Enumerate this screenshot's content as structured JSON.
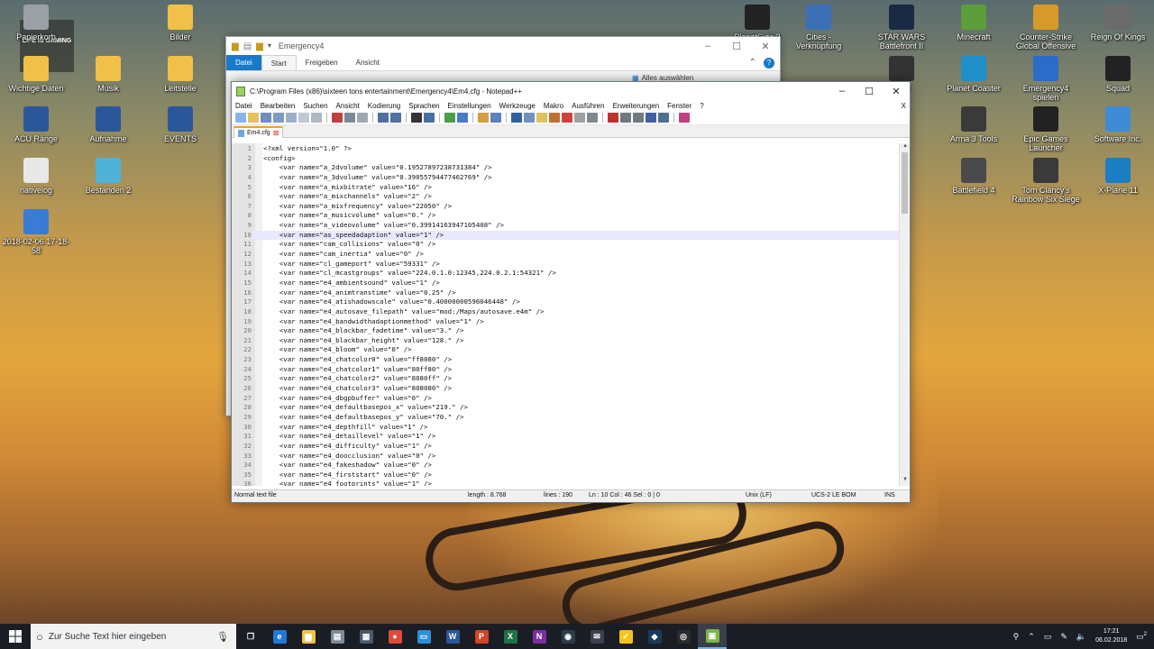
{
  "desktop": {
    "left_icons": [
      {
        "label": "Papierkorb",
        "icon": "recycle-bin-icon",
        "color": "#9aa0a6"
      },
      {
        "label": "Wichtige Daten",
        "icon": "folder-icon",
        "color": "#f0c048"
      },
      {
        "label": "Musik",
        "icon": "folder-icon",
        "color": "#f0c048"
      },
      {
        "label": "Bilder",
        "icon": "folder-icon",
        "color": "#f0c048"
      },
      {
        "label": "Leitstelle",
        "icon": "folder-icon",
        "color": "#f0c048"
      },
      {
        "label": "ACU Ränge",
        "icon": "word-icon",
        "color": "#2b579a"
      },
      {
        "label": "Aufnahme",
        "icon": "word-icon",
        "color": "#2b579a"
      },
      {
        "label": "EVENTS",
        "icon": "word-icon",
        "color": "#2b579a"
      },
      {
        "label": "nativelog",
        "icon": "text-file-icon",
        "color": "#e8e8e8"
      },
      {
        "label": "Bestanden 2",
        "icon": "image-file-icon",
        "color": "#4fb3d9"
      },
      {
        "label": "2018-02-06 17-18-58",
        "icon": "video-file-icon",
        "color": "#3a7bd5"
      }
    ],
    "wallpaper_text": "LIFE IS GAMING",
    "right_icons": [
      {
        "label": "PlanetSide 2",
        "icon": "planetside-icon",
        "color": "#222"
      },
      {
        "label": "Cities - Verknüpfung",
        "icon": "cities-icon",
        "color": "#3b6fb6"
      },
      {
        "label": "STAR WARS Battlefront II",
        "icon": "battlefront-icon",
        "color": "#1a2a44"
      },
      {
        "label": "Minecraft",
        "icon": "minecraft-icon",
        "color": "#5c9e3a"
      },
      {
        "label": "Counter-Strike Global Offensive",
        "icon": "csgo-icon",
        "color": "#d59a2a"
      },
      {
        "label": "Reign Of Kings",
        "icon": "reign-of-kings-icon",
        "color": "#6b6b6b"
      },
      {
        "label": "reed",
        "icon": "app-icon",
        "color": "#333"
      },
      {
        "label": "Planet Coaster",
        "icon": "planet-coaster-icon",
        "color": "#1e8fc9"
      },
      {
        "label": "Emergency4 spielen",
        "icon": "emergency4-icon",
        "color": "#2a6cc7"
      },
      {
        "label": "Squad",
        "icon": "squad-icon",
        "color": "#222"
      },
      {
        "label": "Arma 3 Tools",
        "icon": "arma-icon",
        "color": "#3a3a3a"
      },
      {
        "label": "Epic Games Launcher",
        "icon": "epic-games-icon",
        "color": "#222"
      },
      {
        "label": "Software Inc.",
        "icon": "software-inc-icon",
        "color": "#3e8bd6"
      },
      {
        "label": "Battlefield 4",
        "icon": "battlefield-icon",
        "color": "#4a4a4a"
      },
      {
        "label": "Tom Clancy's Rainbow Six Siege",
        "icon": "rainbow-six-icon",
        "color": "#3a3a3a"
      },
      {
        "label": "X-Plane 11",
        "icon": "x-plane-icon",
        "color": "#1a7ec2"
      }
    ]
  },
  "explorer": {
    "title": "Emergency4",
    "tabs": {
      "file": "Datei",
      "start": "Start",
      "share": "Freigeben",
      "view": "Ansicht"
    },
    "select_all": "Alles auswählen"
  },
  "npp": {
    "title": "C:\\Program Files (x86)\\sixteen tons entertainment\\Emergency4\\Em4.cfg - Notepad++",
    "menu": [
      "Datei",
      "Bearbeiten",
      "Suchen",
      "Ansicht",
      "Kodierung",
      "Sprachen",
      "Einstellungen",
      "Werkzeuge",
      "Makro",
      "Ausführen",
      "Erweiterungen",
      "Fenster",
      "?"
    ],
    "menu_close": "X",
    "tab_name": "Em4.cfg",
    "current_line": 10,
    "lines": [
      "<?xml version=\"1.0\" ?>",
      "<config>",
      "    <var name=\"a_2dvolume\" value=\"0.19527897238731384\" />",
      "    <var name=\"a_3dvolume\" value=\"0.39055794477462769\" />",
      "    <var name=\"a_mixbitrate\" value=\"16\" />",
      "    <var name=\"a_mixchannels\" value=\"2\" />",
      "    <var name=\"a_mixfrequency\" value=\"22050\" />",
      "    <var name=\"a_musicvolume\" value=\"0.\" />",
      "    <var name=\"a_videovolume\" value=\"0.39914163947105408\" />",
      "    <var name=\"as_speedadaption\" value=\"1\" />",
      "    <var name=\"cam_collisions\" value=\"0\" />",
      "    <var name=\"cam_inertia\" value=\"0\" />",
      "    <var name=\"cl_gameport\" value=\"59331\" />",
      "    <var name=\"cl_mcastgroups\" value=\"224.0.1.0:12345,224.0.2.1:54321\" />",
      "    <var name=\"e4_ambientsound\" value=\"1\" />",
      "    <var name=\"e4_animtranstime\" value=\"0.25\" />",
      "    <var name=\"e4_atishadowscale\" value=\"0.40000000596046448\" />",
      "    <var name=\"e4_autosave_filepath\" value=\"mod:/Maps/autosave.e4m\" />",
      "    <var name=\"e4_bandwidthadaptionmethod\" value=\"1\" />",
      "    <var name=\"e4_blackbar_fadetime\" value=\"3.\" />",
      "    <var name=\"e4_blackbar_height\" value=\"128.\" />",
      "    <var name=\"e4_bloom\" value=\"0\" />",
      "    <var name=\"e4_chatcolor0\" value=\"ff8080\" />",
      "    <var name=\"e4_chatcolor1\" value=\"80ff80\" />",
      "    <var name=\"e4_chatcolor2\" value=\"8080ff\" />",
      "    <var name=\"e4_chatcolor3\" value=\"808080\" />",
      "    <var name=\"e4_dbgpbuffer\" value=\"0\" />",
      "    <var name=\"e4_defaultbasepos_x\" value=\"219.\" />",
      "    <var name=\"e4_defaultbasepos_y\" value=\"70.\" />",
      "    <var name=\"e4_depthfill\" value=\"1\" />",
      "    <var name=\"e4_detaillevel\" value=\"1\" />",
      "    <var name=\"e4_difficulty\" value=\"1\" />",
      "    <var name=\"e4_doocclusion\" value=\"0\" />",
      "    <var name=\"e4_fakeshadow\" value=\"0\" />",
      "    <var name=\"e4_firststart\" value=\"0\" />",
      "    <var name=\"e4_footprints\" value=\"1\" />"
    ],
    "status": {
      "type": "Normal text file",
      "length": "length : 8.768",
      "lines": "lines : 190",
      "pos": "Ln : 10    Col : 46    Sel : 0 | 0",
      "eol": "Unix (LF)",
      "encoding": "UCS-2 LE BOM",
      "mode": "INS"
    }
  },
  "taskbar": {
    "search_placeholder": "Zur Suche Text hier eingeben",
    "apps": [
      {
        "name": "task-view-icon",
        "glyph": "❐",
        "color": "#1b1d24"
      },
      {
        "name": "edge-icon",
        "glyph": "e",
        "color": "#1e7ad6"
      },
      {
        "name": "file-explorer-icon",
        "glyph": "▆",
        "color": "#f0c048"
      },
      {
        "name": "printer-icon",
        "glyph": "▤",
        "color": "#7d8a99"
      },
      {
        "name": "calculator-icon",
        "glyph": "▦",
        "color": "#4b5a6b"
      },
      {
        "name": "chrome-icon",
        "glyph": "●",
        "color": "#e04a3a"
      },
      {
        "name": "tv-icon",
        "glyph": "▭",
        "color": "#2a90d8"
      },
      {
        "name": "word-icon",
        "glyph": "W",
        "color": "#2b579a"
      },
      {
        "name": "powerpoint-icon",
        "glyph": "P",
        "color": "#d04423"
      },
      {
        "name": "excel-icon",
        "glyph": "X",
        "color": "#1f7244"
      },
      {
        "name": "onenote-icon",
        "glyph": "N",
        "color": "#7b2f9e"
      },
      {
        "name": "browser-icon",
        "glyph": "◉",
        "color": "#2d3b4a"
      },
      {
        "name": "mail-icon",
        "glyph": "✉",
        "color": "#3a4050"
      },
      {
        "name": "norton-icon",
        "glyph": "✓",
        "color": "#f4c41b"
      },
      {
        "name": "steam-icon",
        "glyph": "◆",
        "color": "#1a3a5c"
      },
      {
        "name": "obs-icon",
        "glyph": "◎",
        "color": "#2b2b2b"
      },
      {
        "name": "notepadpp-icon",
        "glyph": "▣",
        "color": "#7ab648"
      }
    ],
    "time": "17:21",
    "date": "06.02.2018",
    "notifications": "2"
  }
}
